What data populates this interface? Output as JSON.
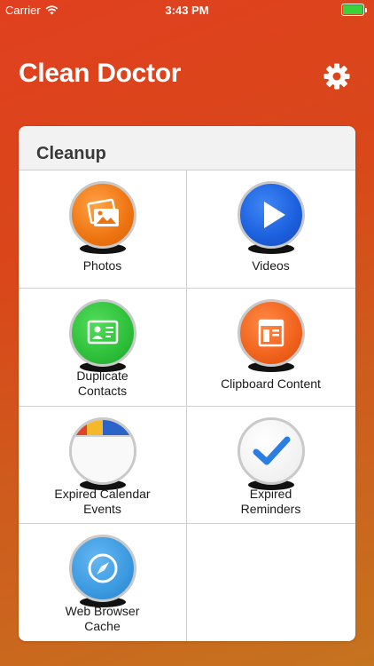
{
  "status_bar": {
    "carrier": "Carrier",
    "time": "3:43 PM",
    "battery_color": "#3cd13c"
  },
  "header": {
    "title": "Clean Doctor",
    "settings_icon": "gear-icon"
  },
  "card": {
    "title": "Cleanup",
    "items": [
      {
        "label_line1": "Photos",
        "label_line2": "",
        "icon": "photos-icon",
        "color": "#f07a12"
      },
      {
        "label_line1": "Videos",
        "label_line2": "",
        "icon": "play-icon",
        "color": "#1c63e0"
      },
      {
        "label_line1": "Duplicate",
        "label_line2": "Contacts",
        "icon": "contact-card-icon",
        "color": "#2fc43a"
      },
      {
        "label_line1": "Clipboard Content",
        "label_line2": "",
        "icon": "clipboard-icon",
        "color": "#f2641c"
      },
      {
        "label_line1": "Expired Calendar",
        "label_line2": "Events",
        "icon": "calendar-icon",
        "color": "#ffffff"
      },
      {
        "label_line1": "Expired",
        "label_line2": "Reminders",
        "icon": "checkmark-icon",
        "color": "#ffffff"
      },
      {
        "label_line1": "Web Browser",
        "label_line2": "Cache",
        "icon": "compass-icon",
        "color": "#3b9ae0"
      }
    ]
  }
}
